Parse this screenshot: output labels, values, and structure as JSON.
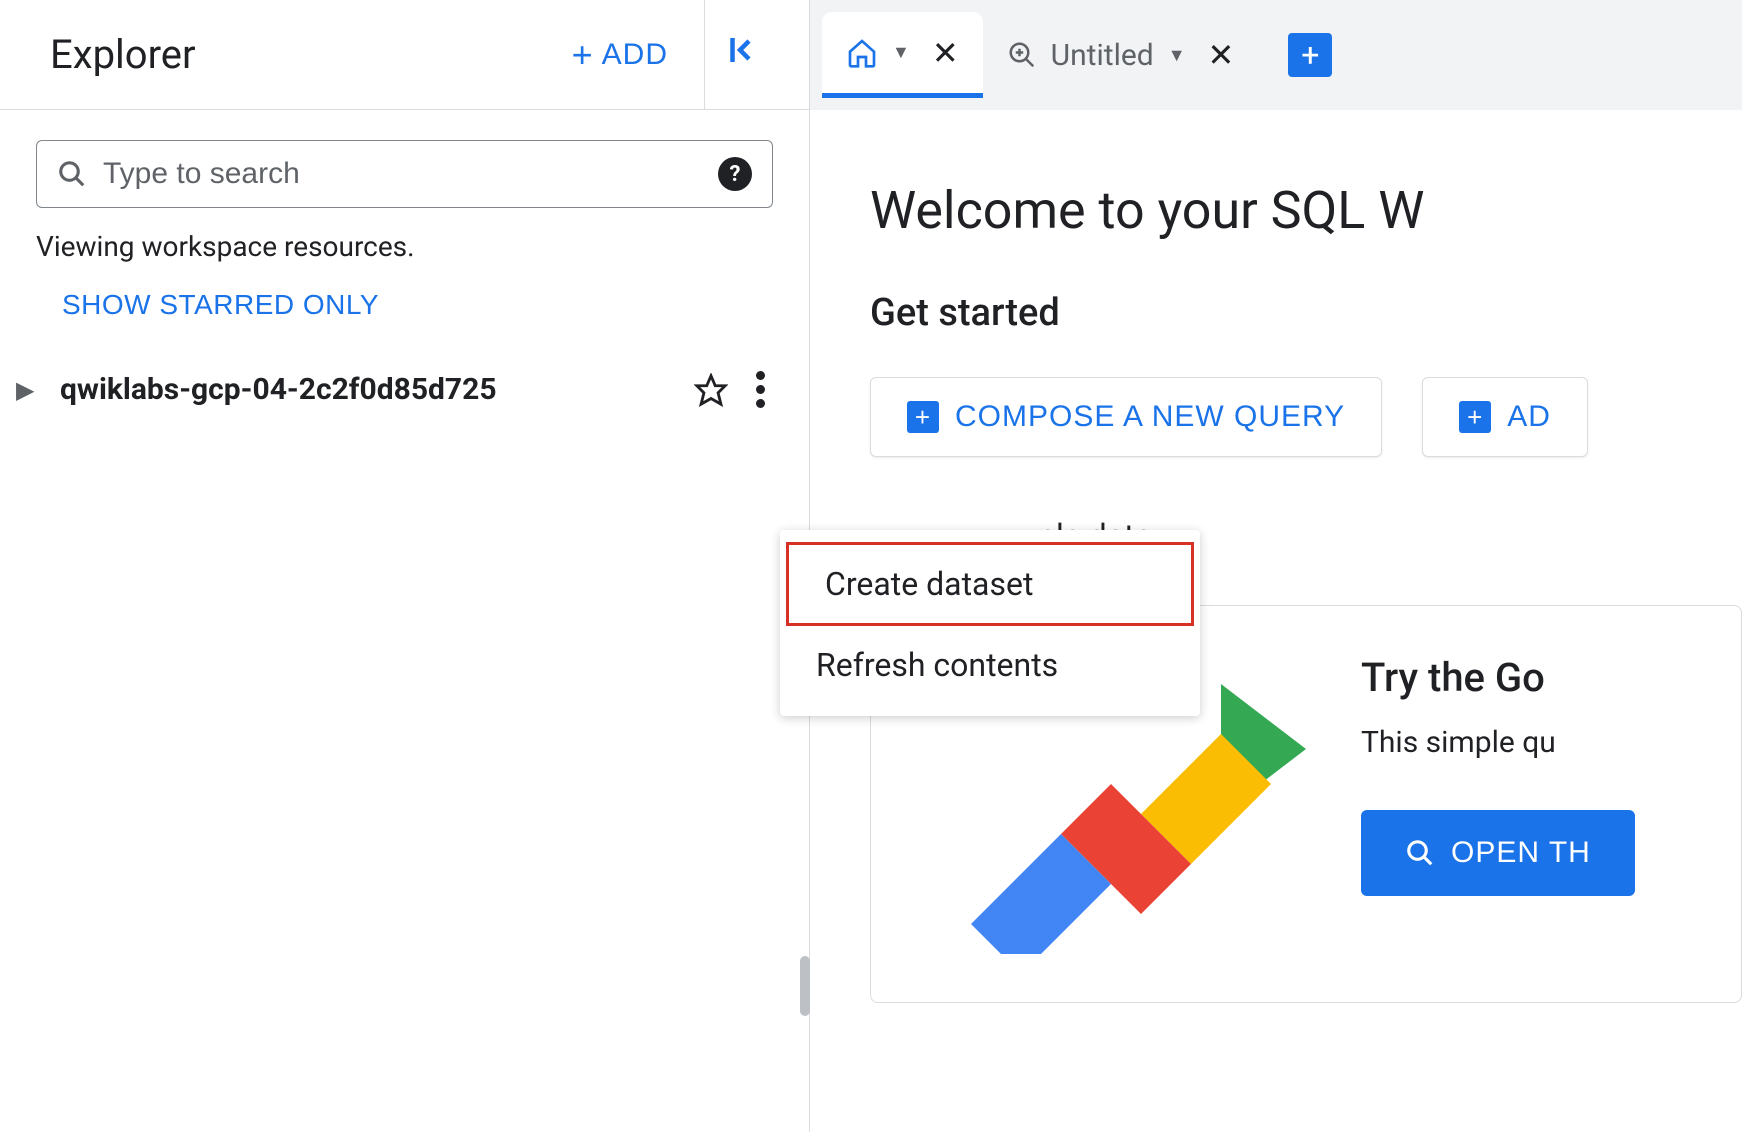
{
  "sidebar": {
    "title": "Explorer",
    "add_label": "ADD",
    "search_placeholder": "Type to search",
    "viewing_text": "Viewing workspace resources.",
    "show_starred_label": "SHOW STARRED ONLY",
    "project_name": "qwiklabs-gcp-04-2c2f0d85d725"
  },
  "context_menu": {
    "create_dataset": "Create dataset",
    "refresh_contents": "Refresh contents"
  },
  "tabs": {
    "untitled_label": "Untitled"
  },
  "main": {
    "welcome_title": "Welcome to your SQL W",
    "get_started": "Get started",
    "compose_query": "COMPOSE A NEW QUERY",
    "add_data_partial": "AD",
    "sample_data_partial": "ple data",
    "card_title": "Try the Go",
    "card_desc": "This simple qu",
    "open_btn": "OPEN TH"
  }
}
